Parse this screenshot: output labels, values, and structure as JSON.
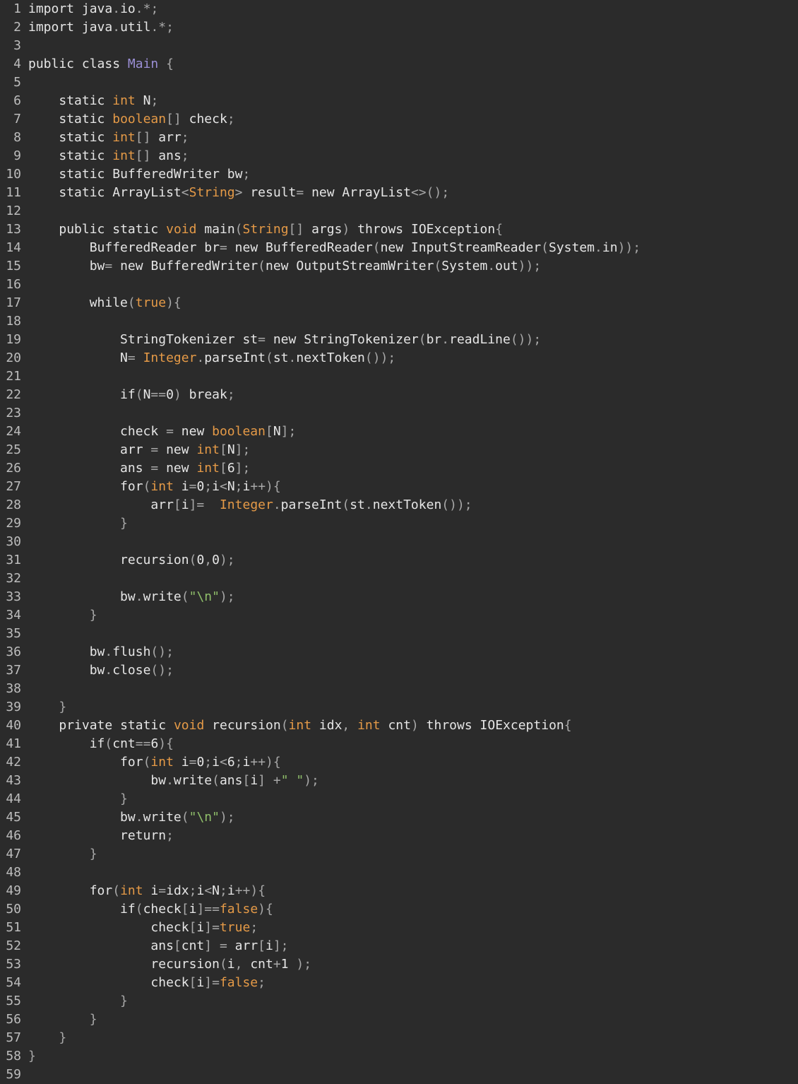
{
  "editor": {
    "language": "java",
    "colors": {
      "background": "#2b2b2b",
      "default": "#e6e6e6",
      "line_number": "#bdbdbd",
      "type": "#e59a47",
      "class_name": "#9b8fd6",
      "string": "#8fbf6a",
      "punctuation": "#a8a8a8"
    },
    "lines": [
      {
        "n": "1",
        "text": "import java.io.*;"
      },
      {
        "n": "2",
        "text": "import java.util.*;"
      },
      {
        "n": "3",
        "text": ""
      },
      {
        "n": "4",
        "text": "public class Main {"
      },
      {
        "n": "5",
        "text": ""
      },
      {
        "n": "6",
        "text": "    static int N;"
      },
      {
        "n": "7",
        "text": "    static boolean[] check;"
      },
      {
        "n": "8",
        "text": "    static int[] arr;"
      },
      {
        "n": "9",
        "text": "    static int[] ans;"
      },
      {
        "n": "10",
        "text": "    static BufferedWriter bw;"
      },
      {
        "n": "11",
        "text": "    static ArrayList<String> result= new ArrayList<>();"
      },
      {
        "n": "12",
        "text": ""
      },
      {
        "n": "13",
        "text": "    public static void main(String[] args) throws IOException{"
      },
      {
        "n": "14",
        "text": "        BufferedReader br= new BufferedReader(new InputStreamReader(System.in));"
      },
      {
        "n": "15",
        "text": "        bw= new BufferedWriter(new OutputStreamWriter(System.out));"
      },
      {
        "n": "16",
        "text": ""
      },
      {
        "n": "17",
        "text": "        while(true){"
      },
      {
        "n": "18",
        "text": ""
      },
      {
        "n": "19",
        "text": "            StringTokenizer st= new StringTokenizer(br.readLine());"
      },
      {
        "n": "20",
        "text": "            N= Integer.parseInt(st.nextToken());"
      },
      {
        "n": "21",
        "text": ""
      },
      {
        "n": "22",
        "text": "            if(N==0) break;"
      },
      {
        "n": "23",
        "text": ""
      },
      {
        "n": "24",
        "text": "            check = new boolean[N];"
      },
      {
        "n": "25",
        "text": "            arr = new int[N];"
      },
      {
        "n": "26",
        "text": "            ans = new int[6];"
      },
      {
        "n": "27",
        "text": "            for(int i=0;i<N;i++){"
      },
      {
        "n": "28",
        "text": "                arr[i]=  Integer.parseInt(st.nextToken());"
      },
      {
        "n": "29",
        "text": "            }"
      },
      {
        "n": "30",
        "text": ""
      },
      {
        "n": "31",
        "text": "            recursion(0,0);"
      },
      {
        "n": "32",
        "text": ""
      },
      {
        "n": "33",
        "text": "            bw.write(\"\\n\");"
      },
      {
        "n": "34",
        "text": "        }"
      },
      {
        "n": "35",
        "text": ""
      },
      {
        "n": "36",
        "text": "        bw.flush();"
      },
      {
        "n": "37",
        "text": "        bw.close();"
      },
      {
        "n": "38",
        "text": ""
      },
      {
        "n": "39",
        "text": "    }"
      },
      {
        "n": "40",
        "text": "    private static void recursion(int idx, int cnt) throws IOException{"
      },
      {
        "n": "41",
        "text": "        if(cnt==6){"
      },
      {
        "n": "42",
        "text": "            for(int i=0;i<6;i++){"
      },
      {
        "n": "43",
        "text": "                bw.write(ans[i] +\" \");"
      },
      {
        "n": "44",
        "text": "            }"
      },
      {
        "n": "45",
        "text": "            bw.write(\"\\n\");"
      },
      {
        "n": "46",
        "text": "            return;"
      },
      {
        "n": "47",
        "text": "        }"
      },
      {
        "n": "48",
        "text": ""
      },
      {
        "n": "49",
        "text": "        for(int i=idx;i<N;i++){"
      },
      {
        "n": "50",
        "text": "            if(check[i]==false){"
      },
      {
        "n": "51",
        "text": "                check[i]=true;"
      },
      {
        "n": "52",
        "text": "                ans[cnt] = arr[i];"
      },
      {
        "n": "53",
        "text": "                recursion(i, cnt+1 );"
      },
      {
        "n": "54",
        "text": "                check[i]=false;"
      },
      {
        "n": "55",
        "text": "            }"
      },
      {
        "n": "56",
        "text": "        }"
      },
      {
        "n": "57",
        "text": "    }"
      },
      {
        "n": "58",
        "text": "}"
      },
      {
        "n": "59",
        "text": ""
      }
    ]
  }
}
